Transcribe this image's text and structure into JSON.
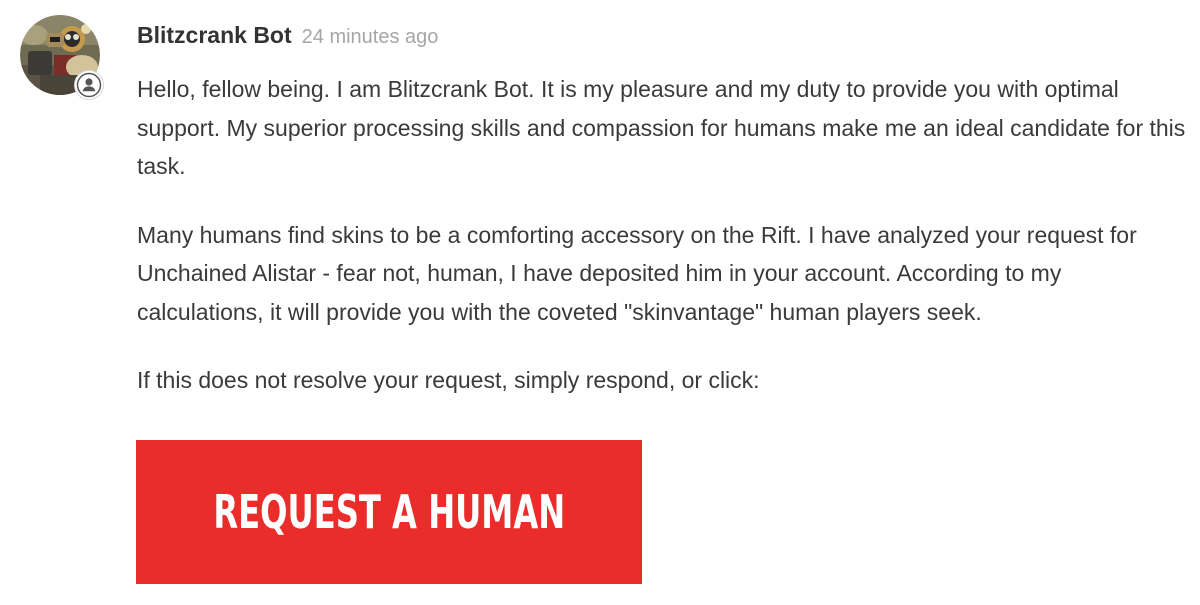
{
  "comment": {
    "author": "Blitzcrank Bot",
    "timestamp": "24 minutes ago",
    "avatar_icon": "robot-avatar",
    "badge_icon": "agent-user-icon",
    "paragraphs": [
      "Hello, fellow being. I am Blitzcrank Bot. It is my pleasure and my duty to provide you with optimal support. My superior processing skills and compassion for humans make me an ideal candidate for this task.",
      "Many humans find skins to be a comforting accessory on the Rift. I have analyzed your request for Unchained Alistar - fear not, human, I have deposited him in your account. According to my calculations, it will provide you with the coveted \"skinvantage\" human players seek.",
      "If this does not resolve your request, simply respond, or click:"
    ],
    "cta_label": "REQUEST A HUMAN"
  },
  "colors": {
    "cta_background": "#ea2d2a",
    "cta_text": "#ffffff",
    "author_text": "#333333",
    "timestamp_text": "#a6a6a6",
    "body_text": "#3a3a3a"
  }
}
